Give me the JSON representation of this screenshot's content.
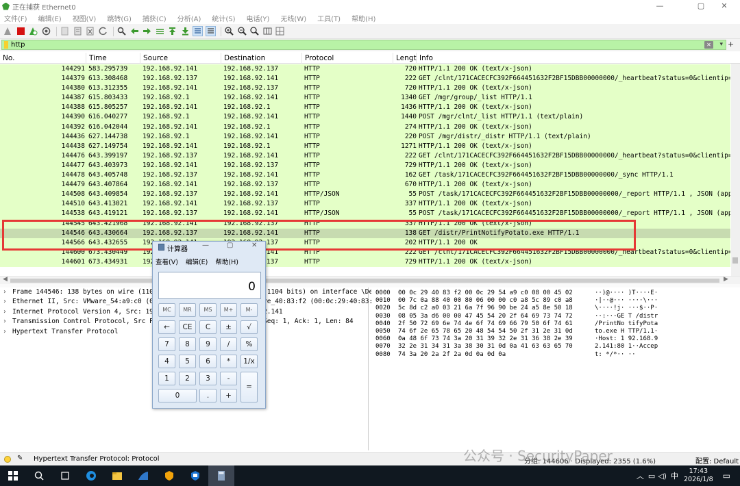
{
  "window": {
    "title": "正在捕获 Ethernet0",
    "minimize": "—",
    "maximize": "▢",
    "close": "✕"
  },
  "menu": [
    "文件(F)",
    "编辑(E)",
    "视图(V)",
    "跳转(G)",
    "捕获(C)",
    "分析(A)",
    "统计(S)",
    "电话(Y)",
    "无线(W)",
    "工具(T)",
    "帮助(H)"
  ],
  "filter": {
    "value": "http",
    "clear": "✕",
    "dropdown": "▾",
    "add": "+"
  },
  "columns": [
    "No.",
    "Time",
    "Source",
    "Destination",
    "Protocol",
    "Lengt",
    "Info"
  ],
  "packets": [
    {
      "no": "144291",
      "time": "583.295739",
      "src": "192.168.92.141",
      "dst": "192.168.92.137",
      "proto": "HTTP",
      "len": "720",
      "info": "HTTP/1.1 200 OK  (text/x-json)"
    },
    {
      "no": "144379",
      "time": "613.308468",
      "src": "192.168.92.137",
      "dst": "192.168.92.141",
      "proto": "HTTP",
      "len": "222",
      "info": "GET /clnt/171CACECFC392F664451632F2BF15DBB00000000/_heartbeat?status=0&clientip=192"
    },
    {
      "no": "144380",
      "time": "613.312355",
      "src": "192.168.92.141",
      "dst": "192.168.92.137",
      "proto": "HTTP",
      "len": "720",
      "info": "HTTP/1.1 200 OK  (text/x-json)"
    },
    {
      "no": "144387",
      "time": "615.803433",
      "src": "192.168.92.1",
      "dst": "192.168.92.141",
      "proto": "HTTP",
      "len": "1340",
      "info": "GET /mgr/group/_list HTTP/1.1"
    },
    {
      "no": "144388",
      "time": "615.805257",
      "src": "192.168.92.141",
      "dst": "192.168.92.1",
      "proto": "HTTP",
      "len": "1436",
      "info": "HTTP/1.1 200 OK  (text/x-json)"
    },
    {
      "no": "144390",
      "time": "616.040277",
      "src": "192.168.92.1",
      "dst": "192.168.92.141",
      "proto": "HTTP",
      "len": "1440",
      "info": "POST /mgr/clnt/_list HTTP/1.1  (text/plain)"
    },
    {
      "no": "144392",
      "time": "616.042044",
      "src": "192.168.92.141",
      "dst": "192.168.92.1",
      "proto": "HTTP",
      "len": "274",
      "info": "HTTP/1.1 200 OK  (text/x-json)"
    },
    {
      "no": "144436",
      "time": "627.144738",
      "src": "192.168.92.1",
      "dst": "192.168.92.141",
      "proto": "HTTP",
      "len": "220",
      "info": "POST /mgr/distr/_distr HTTP/1.1  (text/plain)"
    },
    {
      "no": "144438",
      "time": "627.149754",
      "src": "192.168.92.141",
      "dst": "192.168.92.1",
      "proto": "HTTP",
      "len": "1271",
      "info": "HTTP/1.1 200 OK  (text/x-json)"
    },
    {
      "no": "144476",
      "time": "643.399197",
      "src": "192.168.92.137",
      "dst": "192.168.92.141",
      "proto": "HTTP",
      "len": "222",
      "info": "GET /clnt/171CACECFC392F664451632F2BF15DBB00000000/_heartbeat?status=0&clientip=192"
    },
    {
      "no": "144477",
      "time": "643.403973",
      "src": "192.168.92.141",
      "dst": "192.168.92.137",
      "proto": "HTTP",
      "len": "729",
      "info": "HTTP/1.1 200 OK  (text/x-json)"
    },
    {
      "no": "144478",
      "time": "643.405748",
      "src": "192.168.92.137",
      "dst": "192.168.92.141",
      "proto": "HTTP",
      "len": "162",
      "info": "GET /task/171CACECFC392F664451632F2BF15DBB00000000/_sync HTTP/1.1"
    },
    {
      "no": "144479",
      "time": "643.407864",
      "src": "192.168.92.141",
      "dst": "192.168.92.137",
      "proto": "HTTP",
      "len": "670",
      "info": "HTTP/1.1 200 OK  (text/x-json)"
    },
    {
      "no": "144508",
      "time": "643.409854",
      "src": "192.168.92.137",
      "dst": "192.168.92.141",
      "proto": "HTTP/JSON",
      "len": "55",
      "info": "POST /task/171CACECFC392F664451632F2BF15DBB00000000/_report HTTP/1.1 , JSON (appl:"
    },
    {
      "no": "144510",
      "time": "643.413021",
      "src": "192.168.92.141",
      "dst": "192.168.92.137",
      "proto": "HTTP",
      "len": "337",
      "info": "HTTP/1.1 200 OK  (text/x-json)"
    },
    {
      "no": "144538",
      "time": "643.419121",
      "src": "192.168.92.137",
      "dst": "192.168.92.141",
      "proto": "HTTP/JSON",
      "len": "55",
      "info": "POST /task/171CACECFC392F664451632F2BF15DBB00000000/_report HTTP/1.1 , JSON (appl:"
    },
    {
      "no": "144545",
      "time": "643.421968",
      "src": "192.168.92.141",
      "dst": "192.168.92.137",
      "proto": "HTTP",
      "len": "337",
      "info": "HTTP/1.1 200 OK  (text/x-json)"
    },
    {
      "no": "144546",
      "time": "643.430664",
      "src": "192.168.92.137",
      "dst": "192.168.92.141",
      "proto": "HTTP",
      "len": "138",
      "info": "GET /distr/PrintNotifyPotato.exe HTTP/1.1"
    },
    {
      "no": "144566",
      "time": "643.432655",
      "src": "192.168.92.141",
      "dst": "192.168.92.137",
      "proto": "HTTP",
      "len": "202",
      "info": "HTTP/1.1 200 OK"
    },
    {
      "no": "144600",
      "time": "673.430449",
      "src": "192.168.92.137",
      "dst": "192.168.92.141",
      "proto": "HTTP",
      "len": "222",
      "info": "GET /clnt/171CACECFC392F664451632F2BF15DBB00000000/_heartbeat?status=0&clientip=192"
    },
    {
      "no": "144601",
      "time": "673.434931",
      "src": "192.168.92.141",
      "dst": "192.168.92.137",
      "proto": "HTTP",
      "len": "729",
      "info": "HTTP/1.1 200 OK  (text/x-json)"
    }
  ],
  "selected_packet": "144546",
  "details": [
    "Frame 144546: 138 bytes on wire (1104 bits), 138 bytes captured (1104 bits) on interface \\Dev",
    "Ethernet II, Src: VMware_54:a9:c0 (00:0c:29:54:a9:c0), Dst: VMware_40:83:f2 (00:0c:29:40:83:",
    "Internet Protocol Version 4, Src: 192.168.92.137, Dst: 192.168.92.141",
    "Transmission Control Protocol, Src Port: 49797, Dst Port: 8080, Seq: 1, Ack: 1, Len: 84",
    "Hypertext Transfer Protocol"
  ],
  "hex": [
    {
      "off": "0000",
      "hex": "00 0c 29 40 83 f2 00 0c   29 54 a9 c0 08 00 45 02",
      "ascii": "··)@···· )T····E·"
    },
    {
      "off": "0010",
      "hex": "00 7c 0a 88 40 00 80 06   00 00 c0 a8 5c 89 c0 a8",
      "ascii": "·|··@··· ····\\···"
    },
    {
      "off": "0020",
      "hex": "5c 8d c2 a0 03 21 6a 7f   96 90 be 24 a5 8e 50 18",
      "ascii": "\\····!j· ···$··P·"
    },
    {
      "off": "0030",
      "hex": "08 05 3a d6 00 00 47 45   54 20 2f 64 69 73 74 72",
      "ascii": "··:···GE T /distr"
    },
    {
      "off": "0040",
      "hex": "2f 50 72 69 6e 74 4e 6f   74 69 66 79 50 6f 74 61",
      "ascii": "/PrintNo tifyPota"
    },
    {
      "off": "0050",
      "hex": "74 6f 2e 65 78 65 20 48   54 54 50 2f 31 2e 31 0d",
      "ascii": "to.exe H TTP/1.1·"
    },
    {
      "off": "0060",
      "hex": "0a 48 6f 73 74 3a 20 31   39 32 2e 31 36 38 2e 39",
      "ascii": "·Host: 1 92.168.9"
    },
    {
      "off": "0070",
      "hex": "32 2e 31 34 31 3a 38 30   31 0d 0a 41 63 63 65 70",
      "ascii": "2.141:80 1··Accep"
    },
    {
      "off": "0080",
      "hex": "74 3a 20 2a 2f 2a 0d 0a   0d 0a",
      "ascii": "t: */*·· ··"
    }
  ],
  "calculator": {
    "title": "计算器",
    "menu": [
      "查看(V)",
      "编辑(E)",
      "帮助(H)"
    ],
    "display": "0",
    "keys": [
      "MC",
      "MR",
      "MS",
      "M+",
      "M-",
      "←",
      "CE",
      "C",
      "±",
      "√",
      "7",
      "8",
      "9",
      "/",
      "%",
      "4",
      "5",
      "6",
      "*",
      "1/x",
      "1",
      "2",
      "3",
      "-",
      "=",
      "0",
      ".",
      "+"
    ]
  },
  "status": {
    "protocol": "Hypertext Transfer Protocol: Protocol",
    "packets": "分组: 144606 · Displayed: 2355 (1.6%)",
    "profile": "配置: Default"
  },
  "watermark": "公众号 · SecurityPaper",
  "taskbar": {
    "ime": "中",
    "time": "17:43",
    "date": "2026/1/8"
  }
}
